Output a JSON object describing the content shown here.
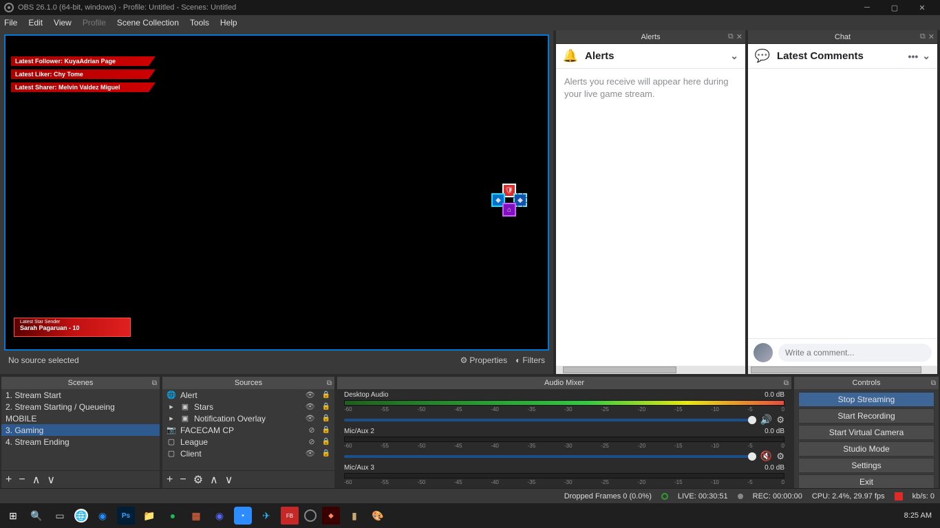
{
  "title": "OBS 26.1.0 (64-bit, windows) - Profile: Untitled - Scenes: Untitled",
  "menu": {
    "file": "File",
    "edit": "Edit",
    "view": "View",
    "profile": "Profile",
    "scene_collection": "Scene Collection",
    "tools": "Tools",
    "help": "Help"
  },
  "preview": {
    "tickers": [
      {
        "label": "Latest Follower: KuyaAdrian Page"
      },
      {
        "label": "Latest Liker: Chy Tome"
      },
      {
        "label": "Latest Sharer: Melvin Valdez Miguel"
      }
    ],
    "star_sender_label": "Latest Star Sender",
    "star_sender_value": "Sarah Pagaruan - 10"
  },
  "source_tools": {
    "none": "No source selected",
    "properties": "Properties",
    "filters": "Filters"
  },
  "docks": {
    "alerts": {
      "title": "Alerts",
      "header": "Alerts",
      "text": "Alerts you receive will appear here during your live game stream."
    },
    "chat": {
      "title": "Chat",
      "header": "Latest Comments",
      "placeholder": "Write a comment..."
    }
  },
  "scenes": {
    "title": "Scenes",
    "items": [
      "1. Stream Start",
      "2. Stream Starting / Queueing",
      "MOBILE",
      "3. Gaming",
      "4. Stream Ending"
    ],
    "selected": 3
  },
  "sources": {
    "title": "Sources",
    "items": [
      {
        "icon": "🌐",
        "label": "Alert",
        "vis": true
      },
      {
        "icon": "▸",
        "label": "Stars",
        "group": true,
        "vis": true
      },
      {
        "icon": "▸",
        "label": "Notification Overlay",
        "group": true,
        "vis": true
      },
      {
        "icon": "📷",
        "label": "FACECAM CP",
        "vis": false
      },
      {
        "icon": "▢",
        "label": "League",
        "vis": false
      },
      {
        "icon": "▢",
        "label": "Client",
        "vis": true
      }
    ]
  },
  "mixer": {
    "title": "Audio Mixer",
    "scale": [
      "-60",
      "-55",
      "-50",
      "-45",
      "-40",
      "-35",
      "-30",
      "-25",
      "-20",
      "-15",
      "-10",
      "-5",
      "0"
    ],
    "tracks": [
      {
        "name": "Desktop Audio",
        "db": "0.0 dB",
        "mask": 0,
        "muted": false
      },
      {
        "name": "Mic/Aux 2",
        "db": "0.0 dB",
        "mask": 100,
        "muted": true
      },
      {
        "name": "Mic/Aux 3",
        "db": "0.0 dB",
        "mask": 100,
        "muted": false
      }
    ]
  },
  "controls": {
    "title": "Controls",
    "buttons": [
      "Stop Streaming",
      "Start Recording",
      "Start Virtual Camera",
      "Studio Mode",
      "Settings",
      "Exit"
    ]
  },
  "status": {
    "dropped": "Dropped Frames 0 (0.0%)",
    "live": "LIVE: 00:30:51",
    "rec": "REC: 00:00:00",
    "cpu": "CPU: 2.4%, 29.97 fps",
    "kb": "kb/s: 0"
  },
  "clock": "8:25 AM"
}
